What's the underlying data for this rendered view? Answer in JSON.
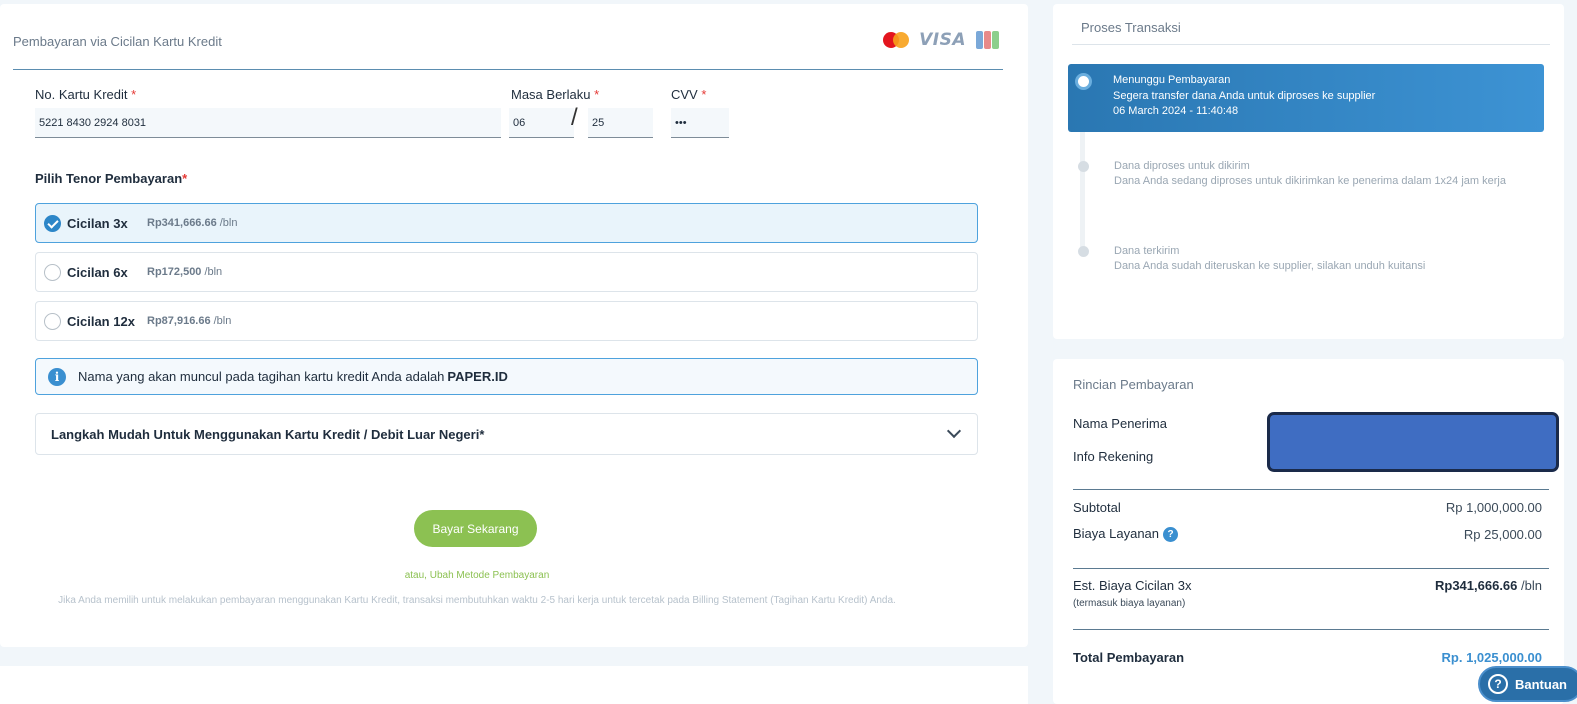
{
  "payment": {
    "title": "Pembayaran via  Cicilan Kartu Kredit",
    "logos": {
      "visa": "VISA"
    },
    "card_number_label": "No. Kartu Kredit",
    "card_number_value": "5221 8430 2924 8031",
    "expiry_label": "Masa Berlaku",
    "expiry_month": "06",
    "expiry_separator": "/",
    "expiry_year": "25",
    "cvv_label": "CVV",
    "cvv_value": "•••",
    "required_mark": "*",
    "tenor_title": "Pilih Tenor Pembayaran",
    "tenors": [
      {
        "label": "Cicilan 3x",
        "price": "Rp341,666.66",
        "unit": "/bln",
        "selected": true
      },
      {
        "label": "Cicilan 6x",
        "price": "Rp172,500",
        "unit": "/bln",
        "selected": false
      },
      {
        "label": "Cicilan 12x",
        "price": "Rp87,916.66",
        "unit": "/bln",
        "selected": false
      }
    ],
    "info_text": "Nama yang akan muncul pada tagihan kartu kredit Anda adalah",
    "info_brand": "PAPER.ID",
    "accordion_label": "Langkah Mudah Untuk Menggunakan Kartu Kredit / Debit Luar Negeri*",
    "pay_button": "Bayar Sekarang",
    "alt_link": "atau, Ubah Metode Pembayaran",
    "note": "Jika Anda memilih untuk melakukan pembayaran menggunakan Kartu Kredit, transaksi membutuhkan waktu 2-5 hari kerja untuk tercetak pada Billing Statement (Tagihan Kartu Kredit) Anda."
  },
  "process": {
    "title": "Proses Transaksi",
    "steps": [
      {
        "title": "Menunggu Pembayaran",
        "desc": "Segera transfer dana Anda untuk diproses ke supplier",
        "time": "06 March 2024 - 11:40:48",
        "active": true
      },
      {
        "title": "Dana diproses untuk dikirim",
        "desc": "Dana Anda sedang diproses untuk dikirimkan ke penerima dalam 1x24 jam kerja",
        "active": false
      },
      {
        "title": "Dana terkirim",
        "desc": "Dana Anda sudah diteruskan ke supplier, silakan unduh kuitansi",
        "active": false
      }
    ]
  },
  "summary": {
    "title": "Rincian Pembayaran",
    "recipient_label": "Nama Penerima",
    "account_label": "Info Rekening",
    "subtotal_label": "Subtotal",
    "subtotal_value": "Rp 1,000,000.00",
    "fee_label": "Biaya Layanan",
    "fee_value": "Rp 25,000.00",
    "est_label": "Est. Biaya Cicilan 3x",
    "est_note": "(termasuk biaya layanan)",
    "est_value": "Rp341,666.66",
    "est_unit": "/bln",
    "total_label": "Total Pembayaran",
    "total_value": "Rp. 1,025,000.00"
  },
  "help": {
    "label": "Bantuan",
    "icon": "?"
  },
  "colors": {
    "accent": "#3a8fd0",
    "green": "#8cc152",
    "required": "#e53935"
  }
}
